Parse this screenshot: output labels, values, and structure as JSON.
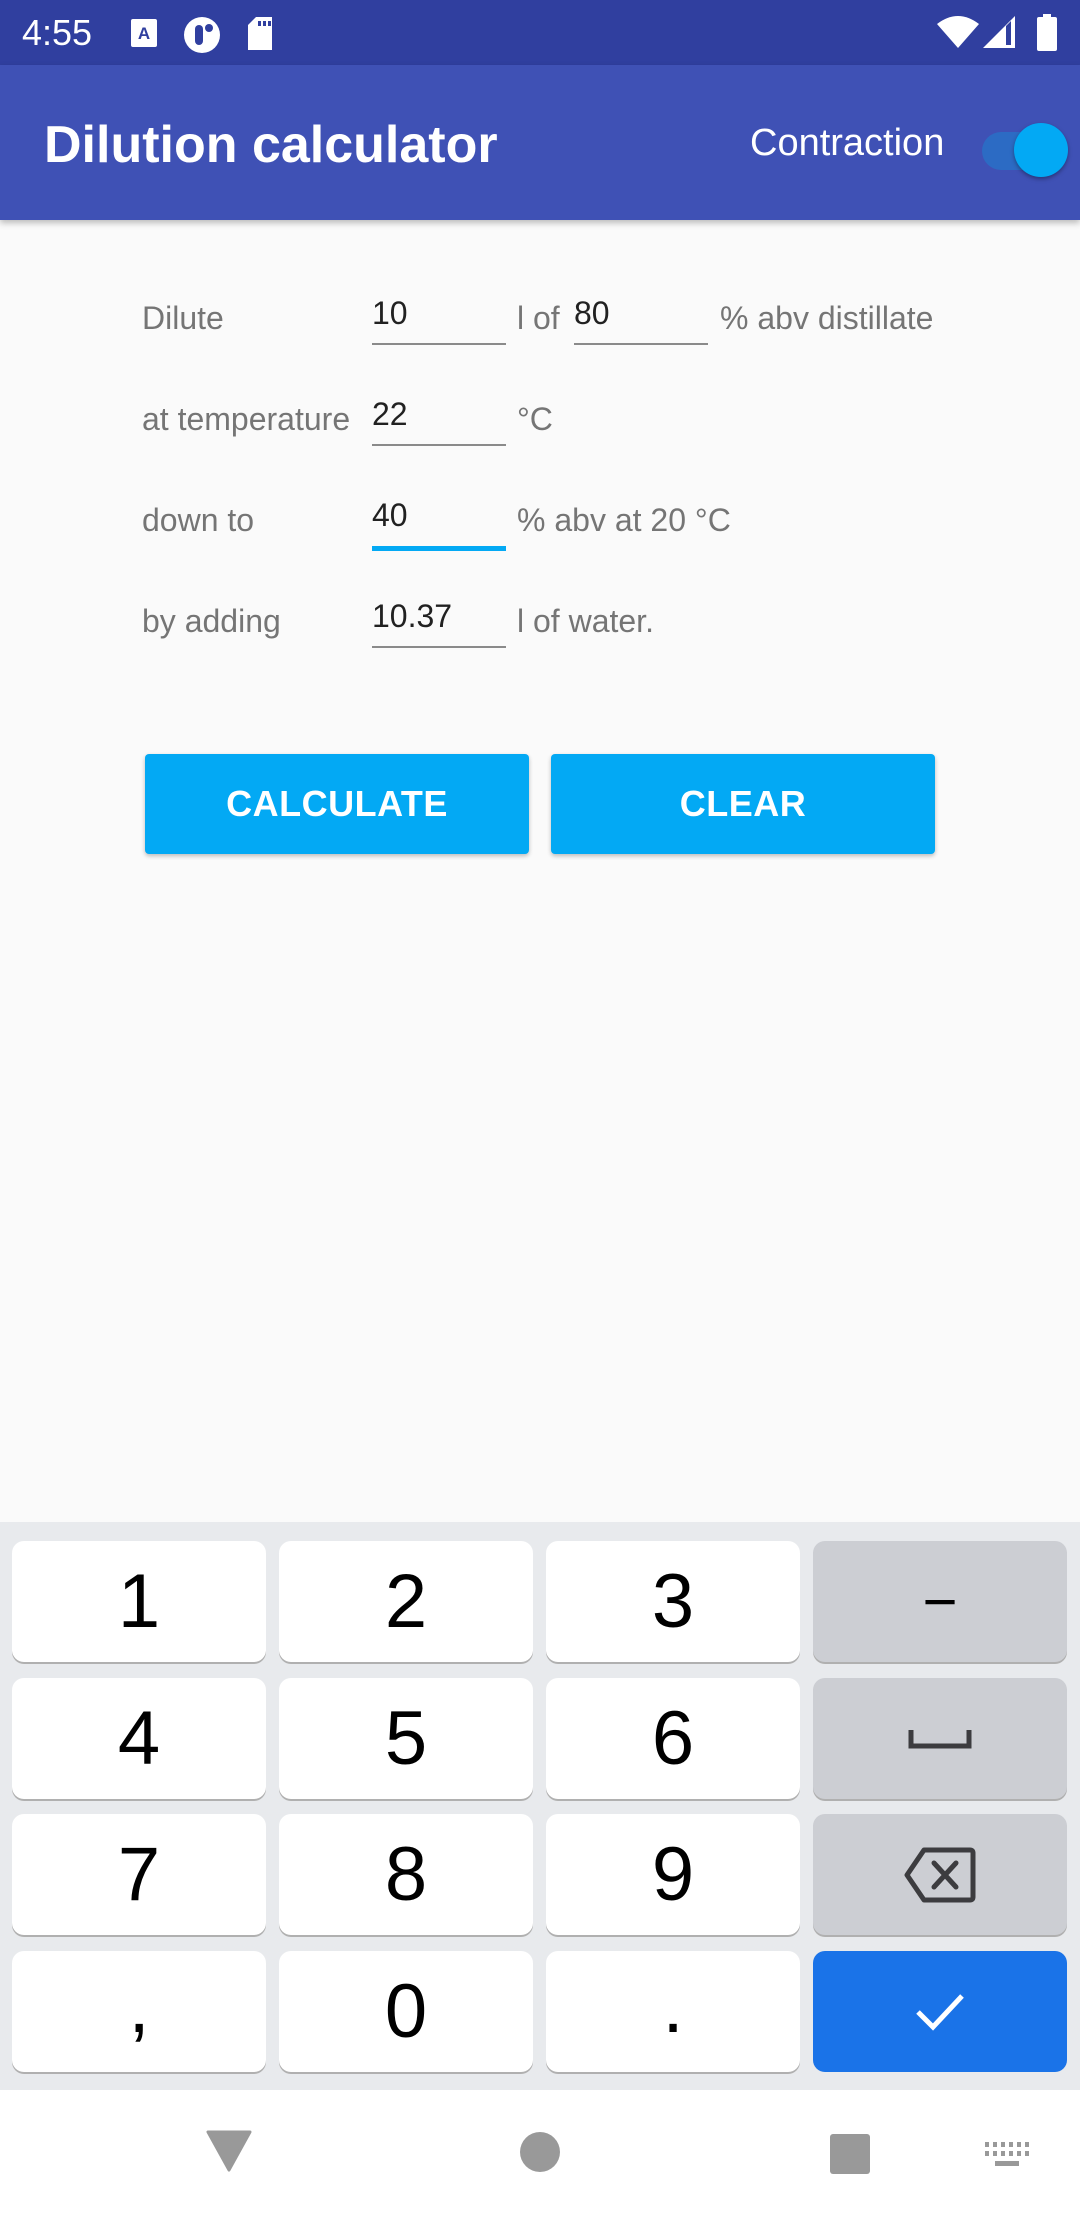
{
  "status_bar": {
    "time": "4:55",
    "left_icons": [
      "accessibility-a-icon",
      "app-notification-icon",
      "sd-card-icon"
    ],
    "right_icons": [
      "wifi-icon",
      "signal-icon",
      "battery-icon"
    ]
  },
  "app_bar": {
    "title": "Dilution calculator",
    "toggle_label": "Contraction",
    "toggle_on": true
  },
  "form": {
    "row1": {
      "label": "Dilute",
      "volume_value": "10",
      "mid_text": "l of",
      "abv_value": "80",
      "suffix": "% abv distillate"
    },
    "row2": {
      "label": "at temperature",
      "temp_value": "22",
      "suffix": "°C"
    },
    "row3": {
      "label": "down to",
      "target_value": "40",
      "suffix": "% abv at 20 °C"
    },
    "row4": {
      "label": "by adding",
      "result_value": "10.37",
      "suffix": "l of water."
    }
  },
  "buttons": {
    "calculate": "CALCULATE",
    "clear": "CLEAR"
  },
  "keyboard": {
    "keys": [
      "1",
      "2",
      "3",
      "−",
      "4",
      "5",
      "6",
      "space",
      "7",
      "8",
      "9",
      "backspace",
      ",",
      "0",
      ".",
      "done"
    ],
    "labels": {
      "k1": "1",
      "k2": "2",
      "k3": "3",
      "minus": "−",
      "k4": "4",
      "k5": "5",
      "k6": "6",
      "k7": "7",
      "k8": "8",
      "k9": "9",
      "comma": ",",
      "k0": "0",
      "dot": "."
    }
  },
  "nav_bar": {
    "icons": [
      "back-icon",
      "home-icon",
      "recents-icon",
      "keyboard-switch-icon"
    ]
  },
  "colors": {
    "status_bar": "#303f9f",
    "app_bar": "#3f51b5",
    "accent": "#03a9f4",
    "done_key": "#1a73e8"
  }
}
